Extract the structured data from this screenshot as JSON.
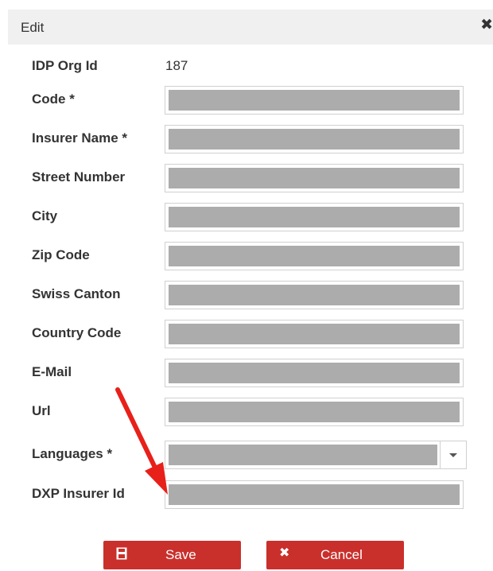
{
  "dialog": {
    "title": "Edit",
    "close_icon": "close-icon",
    "close_glyph": "✖"
  },
  "fields": {
    "idp_org_id": {
      "label": "IDP Org Id",
      "value": "187"
    },
    "code": {
      "label": "Code *",
      "value": ""
    },
    "insurer_name": {
      "label": "Insurer Name *",
      "value": ""
    },
    "street_number": {
      "label": "Street Number",
      "value": ""
    },
    "city": {
      "label": "City",
      "value": ""
    },
    "zip_code": {
      "label": "Zip Code",
      "value": ""
    },
    "swiss_canton": {
      "label": "Swiss Canton",
      "value": ""
    },
    "country_code": {
      "label": "Country Code",
      "value": ""
    },
    "email": {
      "label": "E-Mail",
      "value": ""
    },
    "url": {
      "label": "Url",
      "value": ""
    },
    "languages": {
      "label": "Languages *",
      "value": ""
    },
    "dxp_insurer_id": {
      "label": "DXP Insurer Id",
      "value": ""
    }
  },
  "buttons": {
    "save": {
      "label": "Save",
      "icon": "floppy-disk-icon"
    },
    "cancel": {
      "label": "Cancel",
      "icon": "x-icon",
      "glyph": "✖"
    }
  },
  "annotation": {
    "icon": "red-arrow-icon",
    "color": "#e8201a"
  },
  "colors": {
    "header_bg": "#f0f0f0",
    "field_fill": "#acacac",
    "button_bg": "#c9302c"
  }
}
